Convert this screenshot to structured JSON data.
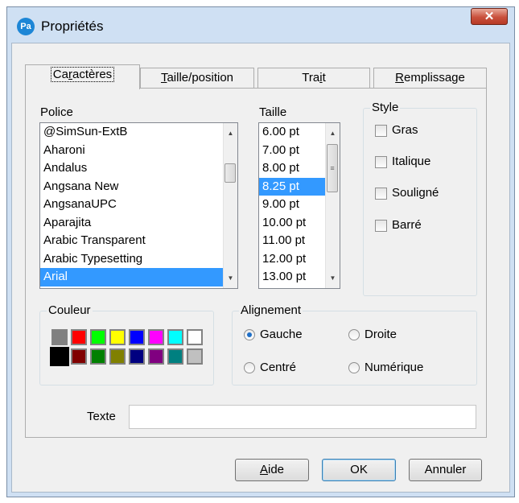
{
  "window": {
    "icon_text": "Pa",
    "title": "Propriétés",
    "close_glyph": "✕"
  },
  "tabs": [
    {
      "label": "Caractères",
      "mnemonic_index": 2,
      "active": true
    },
    {
      "label": "Taille/position",
      "mnemonic_index": 0,
      "active": false
    },
    {
      "label": "Trait",
      "mnemonic_index": 3,
      "active": false
    },
    {
      "label": "Remplissage",
      "mnemonic_index": 0,
      "active": false
    }
  ],
  "font": {
    "label": "Police",
    "items": [
      "@SimSun-ExtB",
      "Aharoni",
      "Andalus",
      "Angsana New",
      "AngsanaUPC",
      "Aparajita",
      "Arabic Transparent",
      "Arabic Typesetting",
      "Arial"
    ],
    "selected": "Arial"
  },
  "size": {
    "label": "Taille",
    "items": [
      "6.00 pt",
      "7.00 pt",
      "8.00 pt",
      "8.25 pt",
      "9.00 pt",
      "10.00 pt",
      "11.00 pt",
      "12.00 pt",
      "13.00 pt"
    ],
    "selected": "8.25 pt"
  },
  "style": {
    "label": "Style",
    "options": [
      {
        "label": "Gras",
        "checked": false
      },
      {
        "label": "Italique",
        "checked": false
      },
      {
        "label": "Souligné",
        "checked": false
      },
      {
        "label": "Barré",
        "checked": false
      }
    ]
  },
  "color": {
    "label": "Couleur",
    "swatches": [
      "#808080",
      "#ff0000",
      "#00ff00",
      "#ffff00",
      "#0000ff",
      "#ff00ff",
      "#00ffff",
      "#ffffff",
      "#000000",
      "#800000",
      "#008000",
      "#808000",
      "#000080",
      "#800080",
      "#008080",
      "#c0c0c0"
    ],
    "selected_index": 8
  },
  "alignment": {
    "label": "Alignement",
    "options": [
      {
        "label": "Gauche",
        "selected": true
      },
      {
        "label": "Droite",
        "selected": false
      },
      {
        "label": "Centré",
        "selected": false
      },
      {
        "label": "Numérique",
        "selected": false
      }
    ]
  },
  "text_field": {
    "label": "Texte",
    "value": ""
  },
  "buttons": {
    "help": "Aide",
    "ok": "OK",
    "cancel": "Annuler"
  }
}
